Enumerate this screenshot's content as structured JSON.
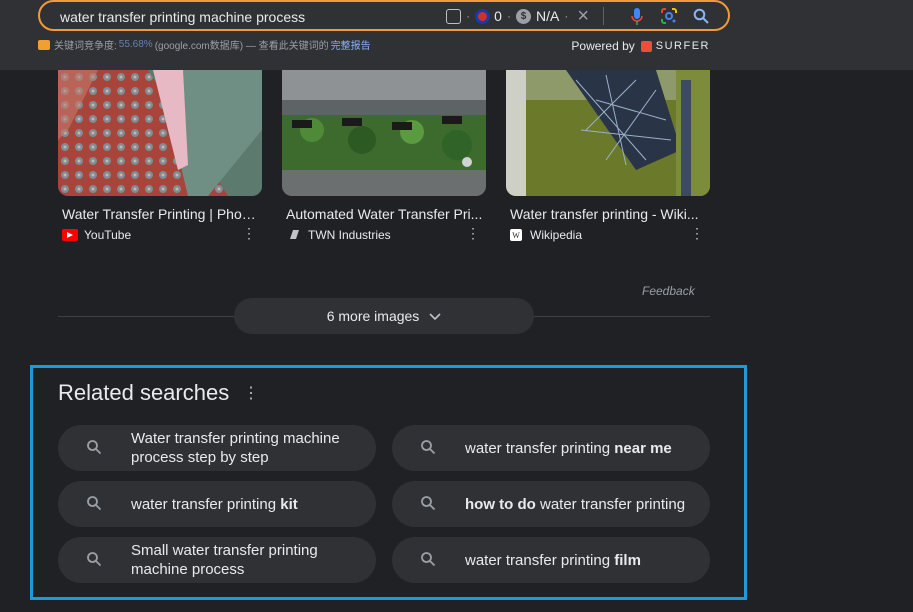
{
  "search": {
    "query": "water transfer printing machine process",
    "pagerank_count": "0",
    "na_label": "N/A"
  },
  "keyword_bar": {
    "label": "关键词竞争度:",
    "percent": "55.68%",
    "source": "(google.com数据库) — 查看此关键词的",
    "report_link": "完整报告"
  },
  "powered": {
    "text": "Powered by",
    "brand": "SURFER"
  },
  "images": [
    {
      "title": "Water Transfer Printing | Phon...",
      "source": "YouTube",
      "source_icon": "youtube-icon",
      "accent": "#ff0000"
    },
    {
      "title": "Automated Water Transfer Pri...",
      "source": "TWN Industries",
      "source_icon": "twn-icon",
      "accent": "#9aa0a6"
    },
    {
      "title": "Water transfer printing - Wiki...",
      "source": "Wikipedia",
      "source_icon": "wikipedia-icon",
      "accent": "#ffffff"
    }
  ],
  "feedback": "Feedback",
  "more_images": "6 more images",
  "related": {
    "heading": "Related searches",
    "items": [
      {
        "pre": "Water transfer printing machine process step by step",
        "bold": "",
        "post": ""
      },
      {
        "pre": "water transfer printing ",
        "bold": "near me",
        "post": ""
      },
      {
        "pre": "water transfer printing ",
        "bold": "kit",
        "post": ""
      },
      {
        "pre": "",
        "bold": "how to do",
        "post": " water transfer printing"
      },
      {
        "pre": "Small water transfer printing machine process",
        "bold": "",
        "post": ""
      },
      {
        "pre": "water transfer printing ",
        "bold": "film",
        "post": ""
      }
    ]
  },
  "colors": {
    "background": "#202124",
    "surface": "#303134",
    "search_outline": "#f29a38",
    "highlight_frame": "#1e9bd7"
  }
}
